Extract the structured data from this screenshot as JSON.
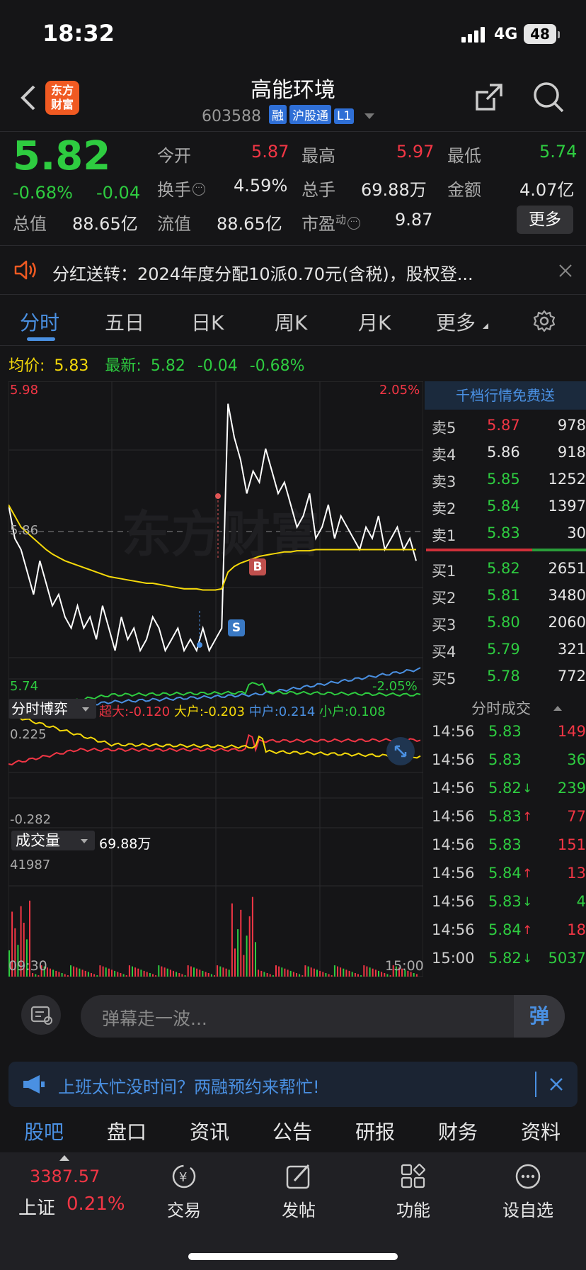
{
  "status": {
    "time": "18:32",
    "network": "4G",
    "battery": "48"
  },
  "header": {
    "title": "高能环境",
    "code": "603588",
    "tags": [
      "融",
      "沪股通",
      "L1"
    ],
    "logo": "东方\n财富"
  },
  "quote": {
    "price": "5.82",
    "change_pct": "-0.68%",
    "change": "-0.04",
    "open_label": "今开",
    "open": "5.87",
    "high_label": "最高",
    "high": "5.97",
    "low_label": "最低",
    "low": "5.74",
    "turnover_label": "换手",
    "turnover": "4.59%",
    "volume_label": "总手",
    "volume": "69.88万",
    "amount_label": "金额",
    "amount": "4.07亿",
    "mktcap_label": "总值",
    "mktcap": "88.65亿",
    "float_label": "流值",
    "float": "88.65亿",
    "pe_label": "市盈",
    "pe_sup": "动",
    "pe": "9.87",
    "more_button": "更多"
  },
  "notice": {
    "text": "分红送转：2024年度分配10派0.70元(含税)，股权登..."
  },
  "tabs": [
    "分时",
    "五日",
    "日K",
    "周K",
    "月K",
    "更多"
  ],
  "info_line": {
    "avg_label": "均价:",
    "avg": "5.83",
    "latest_label": "最新:",
    "latest": "5.82",
    "chg": "-0.04",
    "pct": "-0.68%"
  },
  "chart": {
    "ymax": "5.98",
    "ymin": "5.74",
    "pmax": "2.05%",
    "pmin": "-2.05%",
    "ref": "5.86",
    "watermark": "东方财富",
    "b_marker": "B",
    "s_marker": "S"
  },
  "chart_data": [
    {
      "type": "line",
      "title": "分时",
      "x_range": [
        "09:30",
        "15:00"
      ],
      "ylim": [
        5.74,
        5.98
      ],
      "series": [
        {
          "name": "价格",
          "color": "#ffffff",
          "values": [
            5.87,
            5.84,
            5.83,
            5.81,
            5.79,
            5.82,
            5.8,
            5.78,
            5.79,
            5.77,
            5.76,
            5.78,
            5.76,
            5.77,
            5.75,
            5.78,
            5.76,
            5.74,
            5.77,
            5.75,
            5.76,
            5.74,
            5.75,
            5.77,
            5.76,
            5.74,
            5.75,
            5.76,
            5.74,
            5.75,
            5.74,
            5.76,
            5.74,
            5.75,
            5.76,
            5.96,
            5.93,
            5.91,
            5.88,
            5.9,
            5.89,
            5.92,
            5.9,
            5.88,
            5.89,
            5.87,
            5.85,
            5.86,
            5.88,
            5.84,
            5.85,
            5.87,
            5.84,
            5.86,
            5.85,
            5.84,
            5.83,
            5.85,
            5.84,
            5.86,
            5.83,
            5.84,
            5.85,
            5.83,
            5.84,
            5.82
          ]
        },
        {
          "name": "均价",
          "color": "#f5d90a",
          "values": [
            5.87,
            5.86,
            5.85,
            5.845,
            5.84,
            5.835,
            5.83,
            5.826,
            5.823,
            5.82,
            5.818,
            5.816,
            5.814,
            5.812,
            5.81,
            5.808,
            5.806,
            5.805,
            5.804,
            5.803,
            5.802,
            5.801,
            5.8,
            5.8,
            5.799,
            5.798,
            5.797,
            5.796,
            5.795,
            5.795,
            5.795,
            5.794,
            5.794,
            5.794,
            5.795,
            5.81,
            5.815,
            5.818,
            5.82,
            5.822,
            5.824,
            5.825,
            5.826,
            5.827,
            5.828,
            5.828,
            5.829,
            5.829,
            5.829,
            5.83,
            5.83,
            5.83,
            5.83,
            5.83,
            5.83,
            5.83,
            5.83,
            5.83,
            5.83,
            5.83,
            5.83,
            5.83,
            5.83,
            5.83,
            5.83,
            5.83
          ]
        }
      ]
    },
    {
      "type": "line",
      "title": "分时博弈",
      "ylim": [
        -0.282,
        0.225
      ],
      "series": [
        {
          "name": "超大",
          "value": "-0.120",
          "color": "#f23645"
        },
        {
          "name": "大户",
          "value": "-0.203",
          "color": "#f5d90a"
        },
        {
          "name": "中户",
          "value": "0.214",
          "color": "#4a90e2"
        },
        {
          "name": "小户",
          "value": "0.108",
          "color": "#2ecc40"
        }
      ]
    },
    {
      "type": "bar",
      "title": "成交量",
      "total": "69.88万",
      "ymax": "41987"
    }
  ],
  "orderbook": {
    "banner": "千档行情免费送",
    "asks": [
      {
        "label": "卖5",
        "price": "5.87",
        "vol": "978",
        "color": "#f23645"
      },
      {
        "label": "卖4",
        "price": "5.86",
        "vol": "918",
        "color": "#e6e6e6"
      },
      {
        "label": "卖3",
        "price": "5.85",
        "vol": "1252",
        "color": "#2ecc40"
      },
      {
        "label": "卖2",
        "price": "5.84",
        "vol": "1397",
        "color": "#2ecc40"
      },
      {
        "label": "卖1",
        "price": "5.83",
        "vol": "30",
        "color": "#2ecc40"
      }
    ],
    "bids": [
      {
        "label": "买1",
        "price": "5.82",
        "vol": "2651"
      },
      {
        "label": "买2",
        "price": "5.81",
        "vol": "3480"
      },
      {
        "label": "买3",
        "price": "5.80",
        "vol": "2060"
      },
      {
        "label": "买4",
        "price": "5.79",
        "vol": "321"
      },
      {
        "label": "买5",
        "price": "5.78",
        "vol": "772"
      }
    ],
    "trades_title": "分时成交",
    "trades": [
      {
        "time": "14:56",
        "price": "5.83",
        "arrow": "",
        "vol": "149",
        "color": "#f23645"
      },
      {
        "time": "14:56",
        "price": "5.83",
        "arrow": "",
        "vol": "36",
        "color": "#2ecc40"
      },
      {
        "time": "14:56",
        "price": "5.82",
        "arrow": "↓",
        "vol": "239",
        "color": "#2ecc40"
      },
      {
        "time": "14:56",
        "price": "5.83",
        "arrow": "↑",
        "vol": "77",
        "color": "#f23645"
      },
      {
        "time": "14:56",
        "price": "5.83",
        "arrow": "",
        "vol": "151",
        "color": "#f23645"
      },
      {
        "time": "14:56",
        "price": "5.84",
        "arrow": "↑",
        "vol": "13",
        "color": "#f23645"
      },
      {
        "time": "14:56",
        "price": "5.83",
        "arrow": "↓",
        "vol": "4",
        "color": "#2ecc40"
      },
      {
        "time": "14:56",
        "price": "5.84",
        "arrow": "↑",
        "vol": "18",
        "color": "#f23645"
      },
      {
        "time": "15:00",
        "price": "5.82",
        "arrow": "↓",
        "vol": "5037",
        "color": "#2ecc40"
      }
    ]
  },
  "danmu": {
    "placeholder": "弹幕走一波...",
    "button": "弹"
  },
  "promo": {
    "text": "上班太忙没时间？两融预约来帮忙!"
  },
  "subtabs": [
    "股吧",
    "盘口",
    "资讯",
    "公告",
    "研报",
    "财务",
    "资料"
  ],
  "bottom": {
    "index_value": "3387.57",
    "index_name": "上证",
    "index_pct": "0.21%",
    "items": [
      "交易",
      "发帖",
      "功能",
      "设自选"
    ]
  }
}
